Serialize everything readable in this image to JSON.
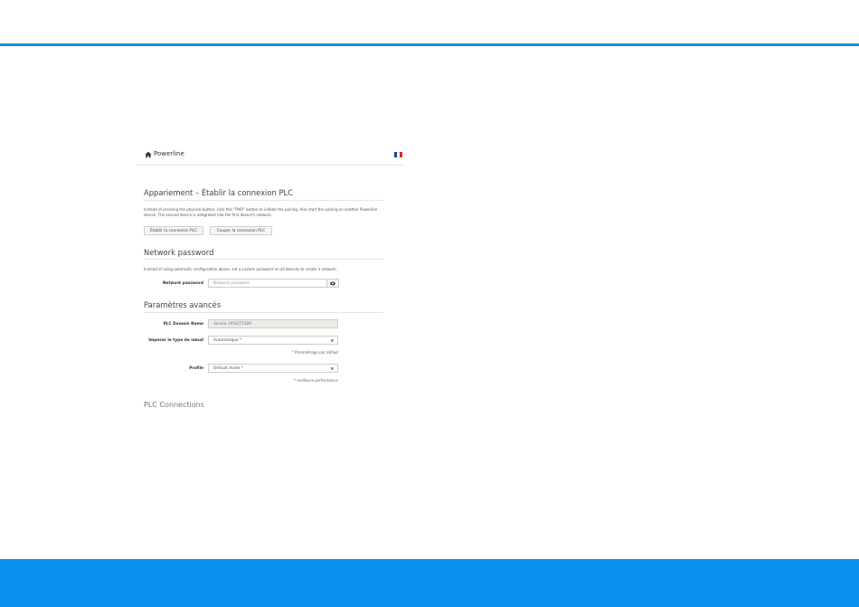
{
  "colors": {
    "accent": "#1b8fe0",
    "footer_band": "#0a8ef0"
  },
  "header": {
    "home_icon": "home-icon",
    "brand": "Powerline",
    "flag_icon": "france-flag-icon"
  },
  "pairing": {
    "title": "Appariement – Établir la connexion PLC",
    "desc": "Instead of pressing the physical button, click this \"PAIR\" button to initiate the pairing. Also start the pairing on another Powerline device. The second device is integrated into the first device's network.",
    "btn_connect": "Établir la connexion PLC",
    "btn_disconnect": "Couper la connexion PLC"
  },
  "network_password": {
    "title": "Network password",
    "desc": "Instead of using automatic configuration above, set a custom password on all devices to create a network.",
    "label": "Network password",
    "placeholder": "Network password",
    "eye_icon": "eye-icon"
  },
  "advanced": {
    "title": "Paramètres avancés",
    "domain_label": "PLC Domain Name",
    "domain_value": "devolo-19%275589",
    "node_label": "Imposer le type de nœud",
    "node_value": "Automatique *",
    "node_hint": "* Paramétrage par défaut",
    "profile_label": "Profile",
    "profile_value": "Default mode *",
    "profile_hint": "* meilleure performance"
  },
  "cut_section": {
    "title": "PLC Connections"
  }
}
